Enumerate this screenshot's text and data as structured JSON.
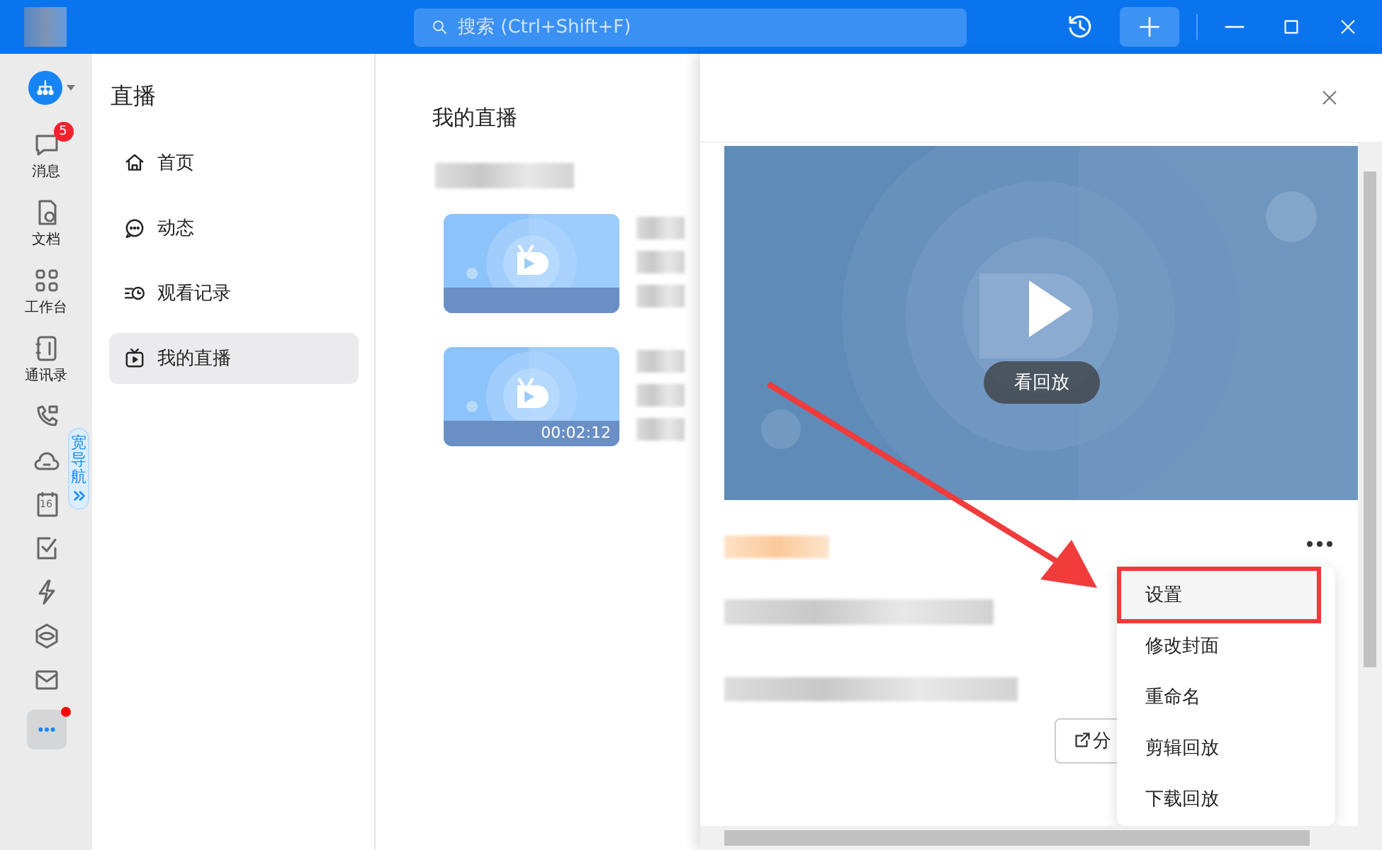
{
  "title_bar": {
    "search_placeholder": "搜索 (Ctrl+Shift+F)"
  },
  "rail": {
    "items": [
      {
        "kind": "org"
      },
      {
        "kind": "message",
        "label": "消息",
        "badge": "5"
      },
      {
        "kind": "docs",
        "label": "文档"
      },
      {
        "kind": "workbench",
        "label": "工作台"
      },
      {
        "kind": "contacts",
        "label": "通讯录"
      },
      {
        "kind": "call"
      },
      {
        "kind": "cloud"
      },
      {
        "kind": "calendar",
        "day": "16"
      },
      {
        "kind": "todo"
      },
      {
        "kind": "flash"
      },
      {
        "kind": "cube"
      },
      {
        "kind": "mail"
      },
      {
        "kind": "more",
        "notify": true
      }
    ],
    "wide_nav": {
      "label": "宽导航"
    }
  },
  "nav": {
    "title": "直播",
    "items": [
      {
        "kind": "home",
        "label": "首页",
        "selected": false
      },
      {
        "kind": "feed",
        "label": "动态",
        "selected": false
      },
      {
        "kind": "history",
        "label": "观看记录",
        "selected": false
      },
      {
        "kind": "live",
        "label": "我的直播",
        "selected": true
      }
    ]
  },
  "list": {
    "title": "我的直播",
    "items": [
      {
        "kind": "video"
      },
      {
        "kind": "video",
        "duration": "00:02:12"
      }
    ]
  },
  "panel": {
    "play_label": "看回放",
    "share_label": "分",
    "menu": [
      {
        "label": "设置",
        "highlighted": true
      },
      {
        "label": "修改封面",
        "highlighted": false
      },
      {
        "label": "重命名",
        "highlighted": false
      },
      {
        "label": "剪辑回放",
        "highlighted": false
      },
      {
        "label": "下载回放",
        "highlighted": false
      }
    ]
  }
}
